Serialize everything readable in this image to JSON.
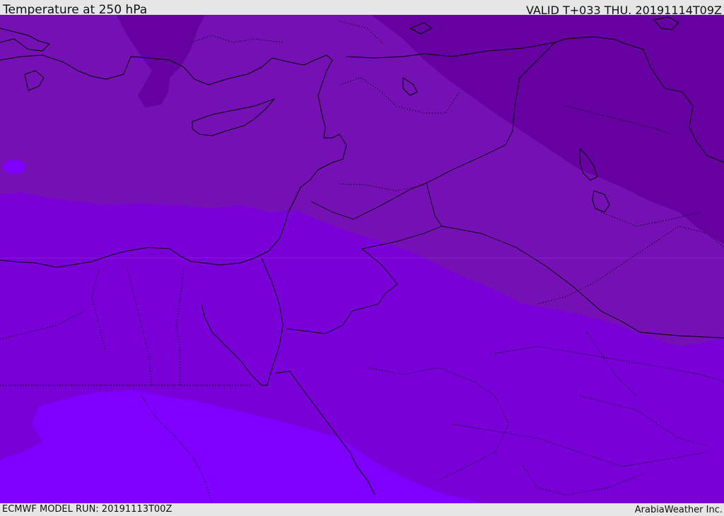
{
  "header": {
    "title": "Temperature at 250 hPa",
    "valid_time": "VALID T+033 THU. 20191114T09Z"
  },
  "footer": {
    "model_run": "ECMWF MODEL RUN: 20191113T00Z",
    "credit": "ArabiaWeather Inc."
  },
  "map": {
    "colors": {
      "band_coldest": "#6600a0",
      "band_cold": "#7410b4",
      "band_mid": "#7a00d8",
      "band_warm": "#7f00ff"
    }
  }
}
